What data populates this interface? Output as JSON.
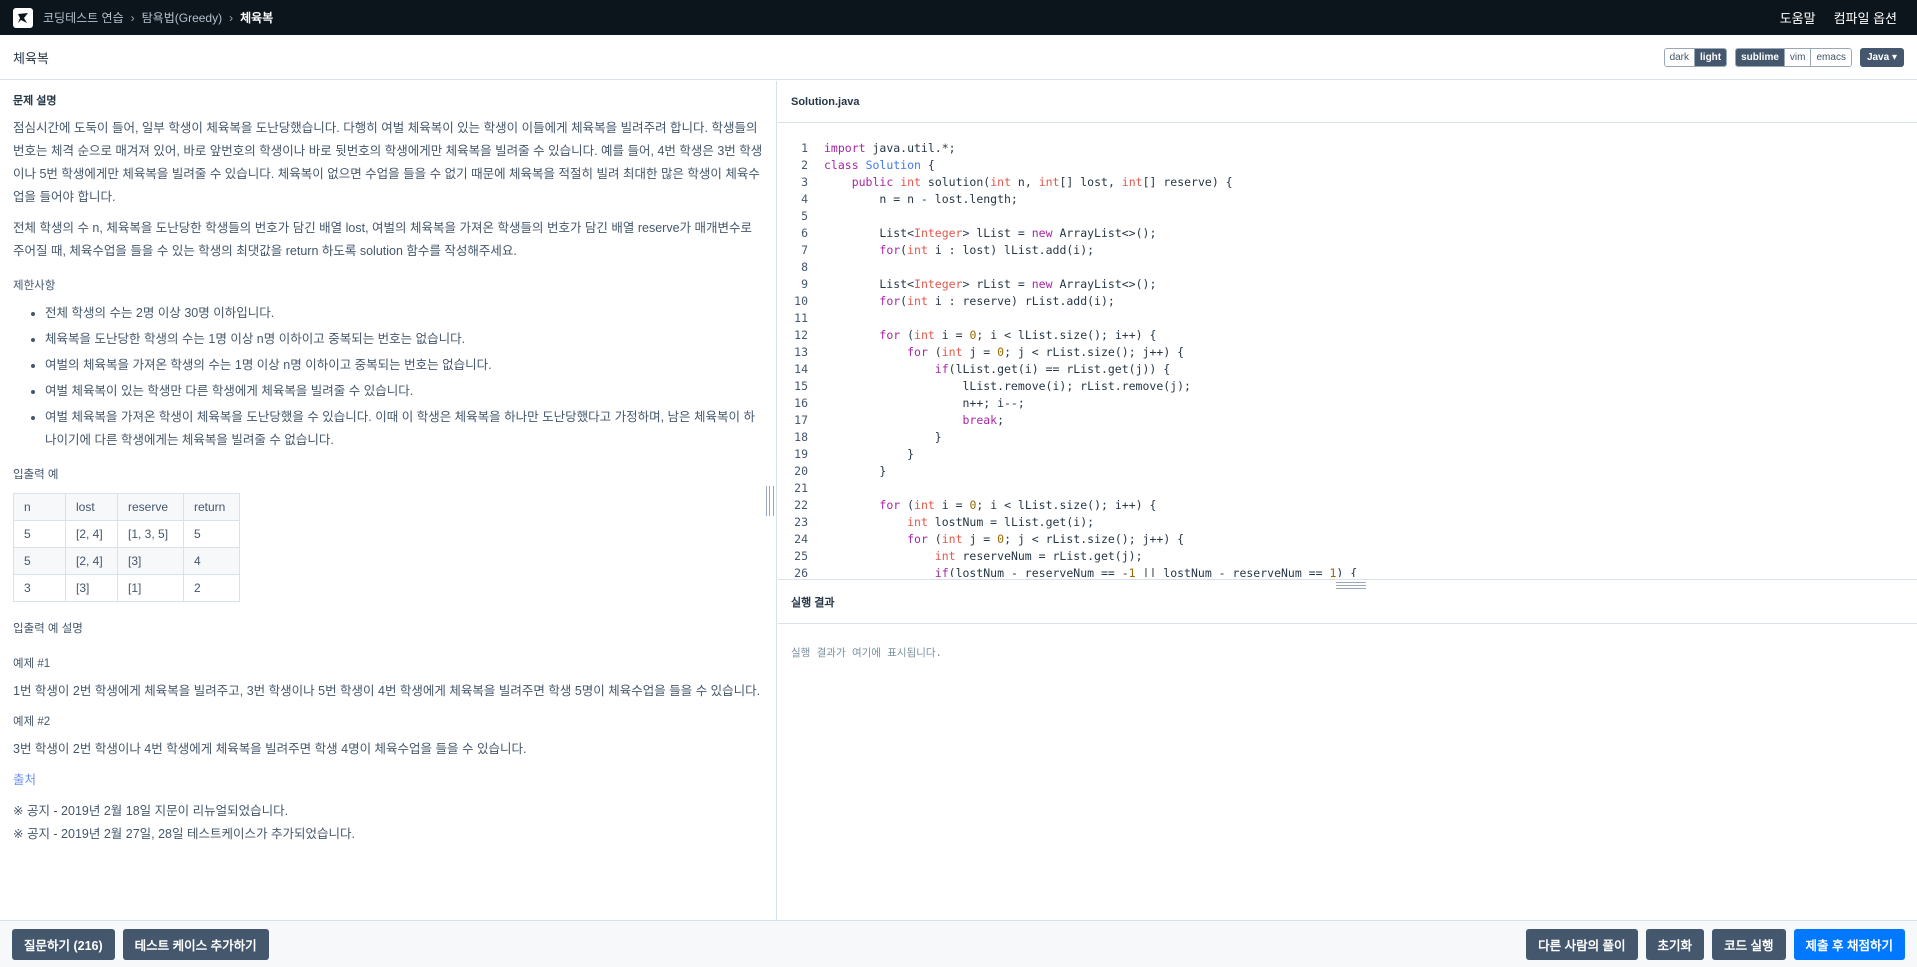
{
  "nav": {
    "crumbs": [
      "코딩테스트 연습",
      "탐욕법(Greedy)",
      "체육복"
    ],
    "help": "도움말",
    "compile_options": "컴파일 옵션"
  },
  "header": {
    "title": "체육복",
    "themes": [
      "dark",
      "light"
    ],
    "active_theme": "light",
    "keymaps": [
      "sublime",
      "vim",
      "emacs"
    ],
    "active_keymap": "sublime",
    "language": "Java"
  },
  "guide": {
    "section_title": "문제 설명",
    "description_1": "점심시간에 도둑이 들어, 일부 학생이 체육복을 도난당했습니다. 다행히 여벌 체육복이 있는 학생이 이들에게 체육복을 빌려주려 합니다. 학생들의 번호는 체격 순으로 매겨져 있어, 바로 앞번호의 학생이나 바로 뒷번호의 학생에게만 체육복을 빌려줄 수 있습니다. 예를 들어, 4번 학생은 3번 학생이나 5번 학생에게만 체육복을 빌려줄 수 있습니다. 체육복이 없으면 수업을 들을 수 없기 때문에 체육복을 적절히 빌려 최대한 많은 학생이 체육수업을 들어야 합니다.",
    "description_2": "전체 학생의 수 n, 체육복을 도난당한 학생들의 번호가 담긴 배열 lost, 여벌의 체육복을 가져온 학생들의 번호가 담긴 배열 reserve가 매개변수로 주어질 때, 체육수업을 들을 수 있는 학생의 최댓값을 return 하도록 solution 함수를 작성해주세요.",
    "constraints_title": "제한사항",
    "constraints": [
      "전체 학생의 수는 2명 이상 30명 이하입니다.",
      "체육복을 도난당한 학생의 수는 1명 이상 n명 이하이고 중복되는 번호는 없습니다.",
      "여벌의 체육복을 가져온 학생의 수는 1명 이상 n명 이하이고 중복되는 번호는 없습니다.",
      "여벌 체육복이 있는 학생만 다른 학생에게 체육복을 빌려줄 수 있습니다.",
      "여벌 체육복을 가져온 학생이 체육복을 도난당했을 수 있습니다. 이때 이 학생은 체육복을 하나만 도난당했다고 가정하며, 남은 체육복이 하나이기에 다른 학생에게는 체육복을 빌려줄 수 없습니다."
    ],
    "io_title": "입출력 예",
    "io_headers": [
      "n",
      "lost",
      "reserve",
      "return"
    ],
    "io_rows": [
      [
        "5",
        "[2, 4]",
        "[1, 3, 5]",
        "5"
      ],
      [
        "5",
        "[2, 4]",
        "[3]",
        "4"
      ],
      [
        "3",
        "[3]",
        "[1]",
        "2"
      ]
    ],
    "io_desc_title": "입출력 예 설명",
    "example1_title": "예제 #1",
    "example1_text": "1번 학생이 2번 학생에게 체육복을 빌려주고, 3번 학생이나 5번 학생이 4번 학생에게 체육복을 빌려주면 학생 5명이 체육수업을 들을 수 있습니다.",
    "example2_title": "예제 #2",
    "example2_text": "3번 학생이 2번 학생이나 4번 학생에게 체육복을 빌려주면 학생 4명이 체육수업을 들을 수 있습니다.",
    "source": "출처",
    "notice_1": "※ 공지 - 2019년 2월 18일 지문이 리뉴얼되었습니다.",
    "notice_2": "※ 공지 - 2019년 2월 27일, 28일 테스트케이스가 추가되었습니다."
  },
  "editor": {
    "filename": "Solution.java",
    "lines": [
      "import java.util.*;",
      "class Solution {",
      "    public int solution(int n, int[] lost, int[] reserve) {",
      "        n = n - lost.length;",
      "",
      "        List<Integer> lList = new ArrayList<>();",
      "        for(int i : lost) lList.add(i);",
      "",
      "        List<Integer> rList = new ArrayList<>();",
      "        for(int i : reserve) rList.add(i);",
      "",
      "        for (int i = 0; i < lList.size(); i++) {",
      "            for (int j = 0; j < rList.size(); j++) {",
      "                if(lList.get(i) == rList.get(j)) {",
      "                    lList.remove(i); rList.remove(j);",
      "                    n++; i--;",
      "                    break;",
      "                }",
      "            }",
      "        }",
      "",
      "        for (int i = 0; i < lList.size(); i++) {",
      "            int lostNum = lList.get(i);",
      "            for (int j = 0; j < rList.size(); j++) {",
      "                int reserveNum = rList.get(j);",
      "                if(lostNum - reserveNum == -1 || lostNum - reserveNum == 1) {"
    ]
  },
  "result": {
    "title": "실행 결과",
    "placeholder": "실행 결과가 여기에 표시됩니다."
  },
  "footer": {
    "ask": "질문하기 (216)",
    "add_testcase": "테스트 케이스 추가하기",
    "others": "다른 사람의 풀이",
    "reset": "초기화",
    "run": "코드 실행",
    "submit": "제출 후 채점하기"
  }
}
